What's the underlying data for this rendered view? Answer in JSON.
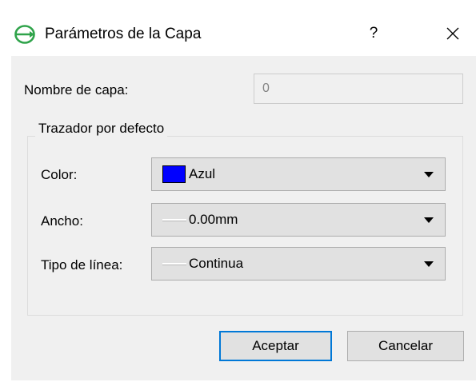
{
  "window": {
    "title": "Parámetros de la Capa",
    "help_label": "?",
    "icon": "green-ellipse-arrow-icon",
    "accent_color": "#0078d7"
  },
  "form": {
    "layer_name": {
      "label": "Nombre de capa:",
      "value": "0"
    },
    "group": {
      "title": "Trazador por defecto",
      "color": {
        "label": "Color:",
        "value": "Azul",
        "swatch_color": "#0000ff"
      },
      "width": {
        "label": "Ancho:",
        "value": "0.00mm"
      },
      "line_type": {
        "label": "Tipo de línea:",
        "value": "Continua"
      }
    }
  },
  "buttons": {
    "ok": "Aceptar",
    "cancel": "Cancelar"
  }
}
